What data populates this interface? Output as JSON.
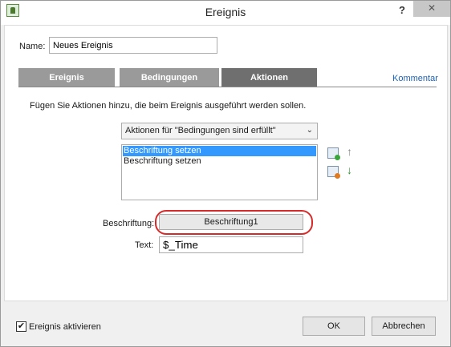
{
  "window": {
    "title": "Ereignis",
    "help": "?",
    "close": "✕"
  },
  "name": {
    "label": "Name:",
    "value": "Neues Ereignis"
  },
  "tabs": [
    {
      "label": "Ereignis"
    },
    {
      "label": "Bedingungen"
    },
    {
      "label": "Aktionen"
    }
  ],
  "comment_link": "Kommentar",
  "description": "Fügen Sie Aktionen hinzu, die beim Ereignis ausgeführt werden sollen.",
  "dropdown": {
    "selected": "Aktionen für \"Bedingungen sind erfüllt\"",
    "chevron": "⌄"
  },
  "actions_list": [
    {
      "label": "Beschriftung setzen",
      "selected": true
    },
    {
      "label": "Beschriftung setzen",
      "selected": false
    }
  ],
  "side_icons": {
    "add": "add-action-icon",
    "remove": "remove-action-icon",
    "up": "↑",
    "down": "↓"
  },
  "beschriftung": {
    "label": "Beschriftung:",
    "value": "Beschriftung1"
  },
  "text": {
    "label": "Text:",
    "value": "$_Time"
  },
  "footer": {
    "checkbox_checked": true,
    "checkbox_mark": "✔",
    "checkbox_label": "Ereignis aktivieren",
    "ok": "OK",
    "cancel": "Abbrechen"
  },
  "colors": {
    "tab_active": "#6f6f6f",
    "tab_inactive": "#9a9a9a",
    "selection": "#3399ff",
    "highlight_ring": "#d62a2a",
    "link": "#1b63b8",
    "arrow_up": "#8a8a8a",
    "arrow_down": "#2e9a2e"
  }
}
